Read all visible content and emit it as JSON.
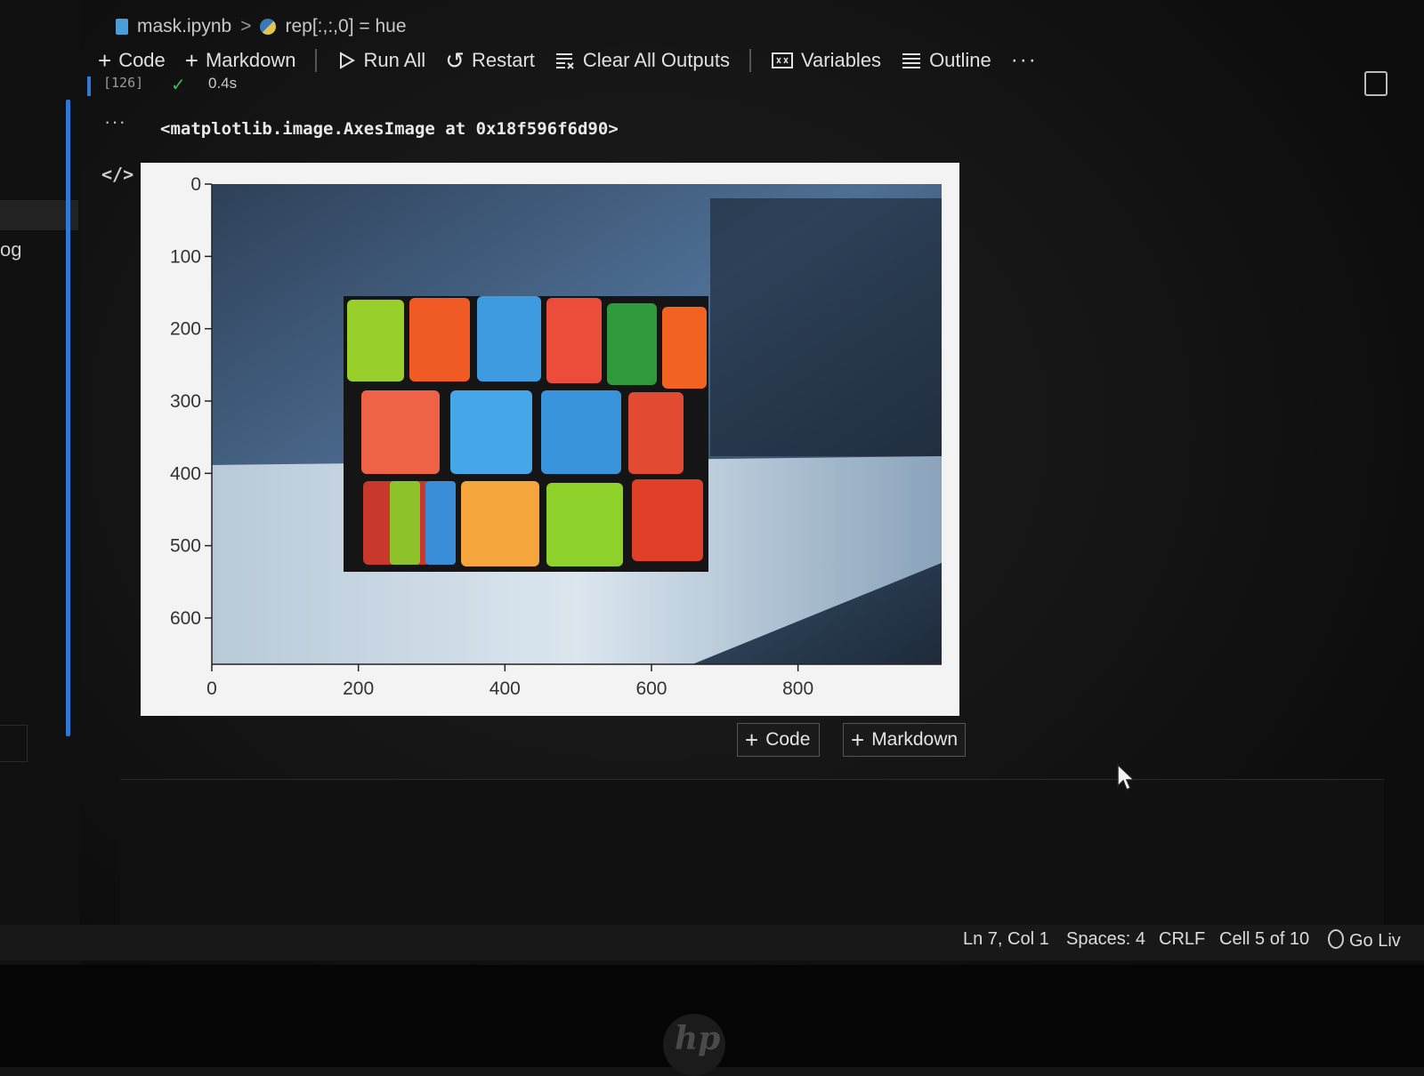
{
  "left_panel": {
    "cut_label": "og"
  },
  "breadcrumb": {
    "file": "mask.ipynb",
    "separator": ">",
    "symbol": "rep[:,:,0] = hue"
  },
  "toolbar": {
    "code_label": "Code",
    "markdown_label": "Markdown",
    "run_all_label": "Run All",
    "restart_label": "Restart",
    "clear_outputs_label": "Clear All Outputs",
    "variables_label": "Variables",
    "outline_label": "Outline",
    "more_label": "···"
  },
  "cell": {
    "execution_count": "[126]",
    "exec_time": "0.4s",
    "output_ellipsis": "···",
    "output_text": "<matplotlib.image.AxesImage at 0x18f596f6d90>"
  },
  "plot": {
    "x_ticks": [
      "0",
      "200",
      "400",
      "600",
      "800"
    ],
    "y_ticks": [
      "0",
      "100",
      "200",
      "300",
      "400",
      "500",
      "600"
    ],
    "image_description_icon": "rubiks-cube-photo"
  },
  "add_cell": {
    "code_label": "Code",
    "markdown_label": "Markdown"
  },
  "statusbar": {
    "position": "Ln 7, Col 1",
    "spaces": "Spaces: 4",
    "eol": "CRLF",
    "cell_info": "Cell 5 of 10",
    "go_live": "Go Liv"
  },
  "colors": {
    "accent": "#2f7bd4",
    "background": "#141414",
    "check": "#3fb950"
  }
}
